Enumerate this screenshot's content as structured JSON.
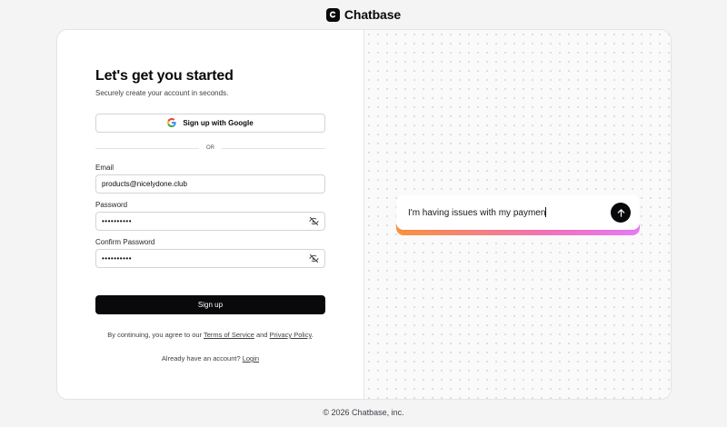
{
  "brand": {
    "name": "Chatbase"
  },
  "form": {
    "title": "Let's get you started",
    "subtitle": "Securely create your account in seconds.",
    "google_button_label": "Sign up with Google",
    "divider_text": "OR",
    "email_label": "Email",
    "email_value": "products@nicelydone.club",
    "password_label": "Password",
    "password_value": "••••••••••",
    "confirm_label": "Confirm Password",
    "confirm_value": "••••••••••",
    "signup_label": "Sign up",
    "terms_prefix": "By continuing, you agree to our ",
    "terms_link": "Terms of Service",
    "terms_and": " and ",
    "privacy_link": "Privacy Policy",
    "terms_suffix": ".",
    "login_prompt": "Already have an account? ",
    "login_link": "Login"
  },
  "chat_demo": {
    "message": "I'm having issues with my paymen"
  },
  "footer": {
    "copyright": "© 2026 Chatbase, inc."
  },
  "icons": {
    "logo": "chatbase-logo-icon",
    "google": "google-icon",
    "password_toggle": "eye-off-icon",
    "send": "arrow-up-icon"
  },
  "colors": {
    "background": "#f4f4f5",
    "primary_button": "#09090b",
    "accent_gradient_start": "#fb923c",
    "accent_gradient_mid": "#f472b6",
    "accent_gradient_end": "#e879f9"
  }
}
